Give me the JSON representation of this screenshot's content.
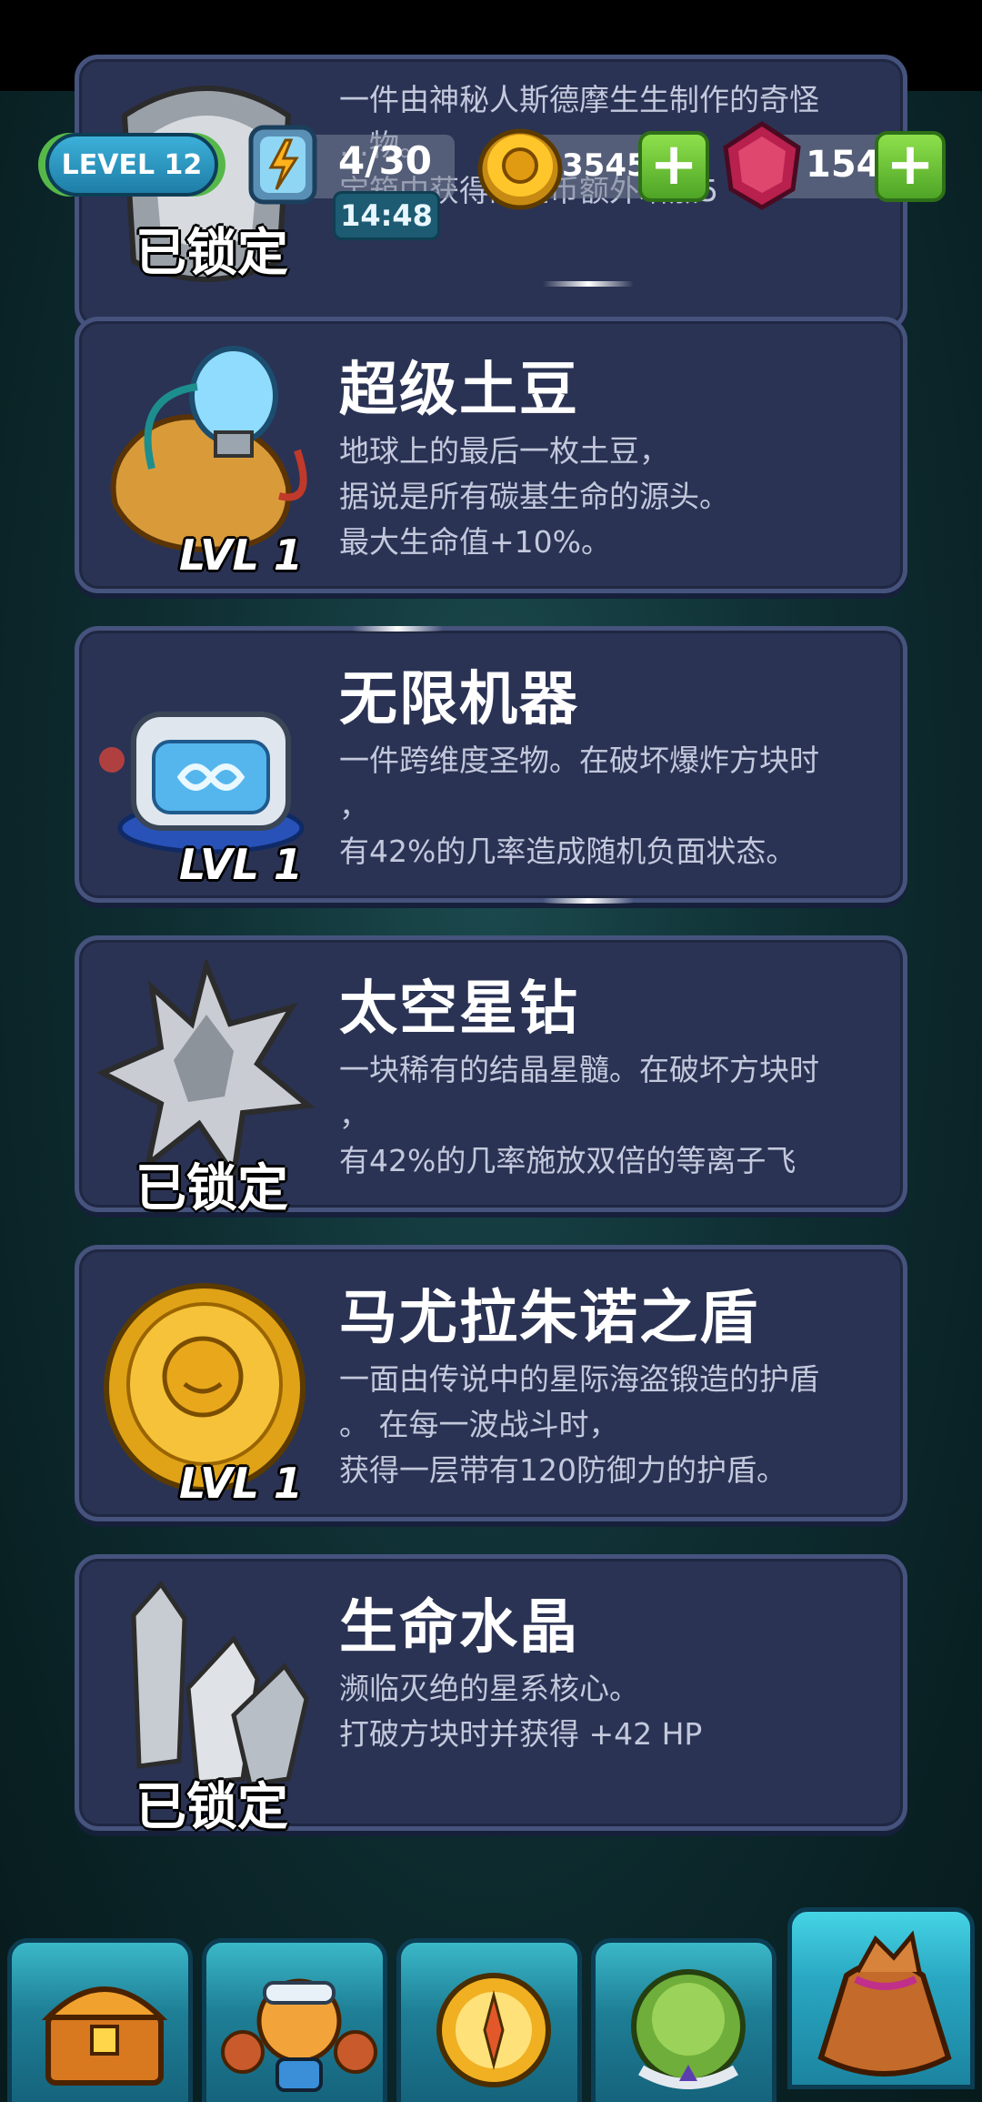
{
  "hud": {
    "level_label": "LEVEL 12",
    "energy": "4/30",
    "timer": "14:48",
    "coins": "35455",
    "gems": "1543"
  },
  "cards": [
    {
      "title": "",
      "desc": "一件由神秘人斯德摩生生制作的奇怪\n…物。\n宝箱中获得的金币额外增加5",
      "status": "已锁定"
    },
    {
      "title": "超级土豆",
      "desc": "地球上的最后一枚土豆，\n据说是所有碳基生命的源头。\n最大生命值+10%。",
      "status": "LVL 1"
    },
    {
      "title": "无限机器",
      "desc": "一件跨维度圣物。在破坏爆炸方块时\n，\n有42%的几率造成随机负面状态。",
      "status": "LVL 1"
    },
    {
      "title": "太空星钻",
      "desc": "一块稀有的结晶星髓。在破坏方块时\n，\n有42%的几率施放双倍的等离子飞",
      "status": "已锁定"
    },
    {
      "title": "马尤拉朱诺之盾",
      "desc": "一面由传说中的星际海盗锻造的护盾\n。 在每一波战斗时，\n获得一层带有120防御力的护盾。",
      "status": "LVL 1"
    },
    {
      "title": "生命水晶",
      "desc": "濒临灭绝的星系核心。\n打破方块时并获得 +42 HP",
      "status": "已锁定"
    }
  ],
  "nav": [
    "chest-icon",
    "hero-icon",
    "compass-icon",
    "helmet-icon",
    "loot-bag-icon"
  ]
}
